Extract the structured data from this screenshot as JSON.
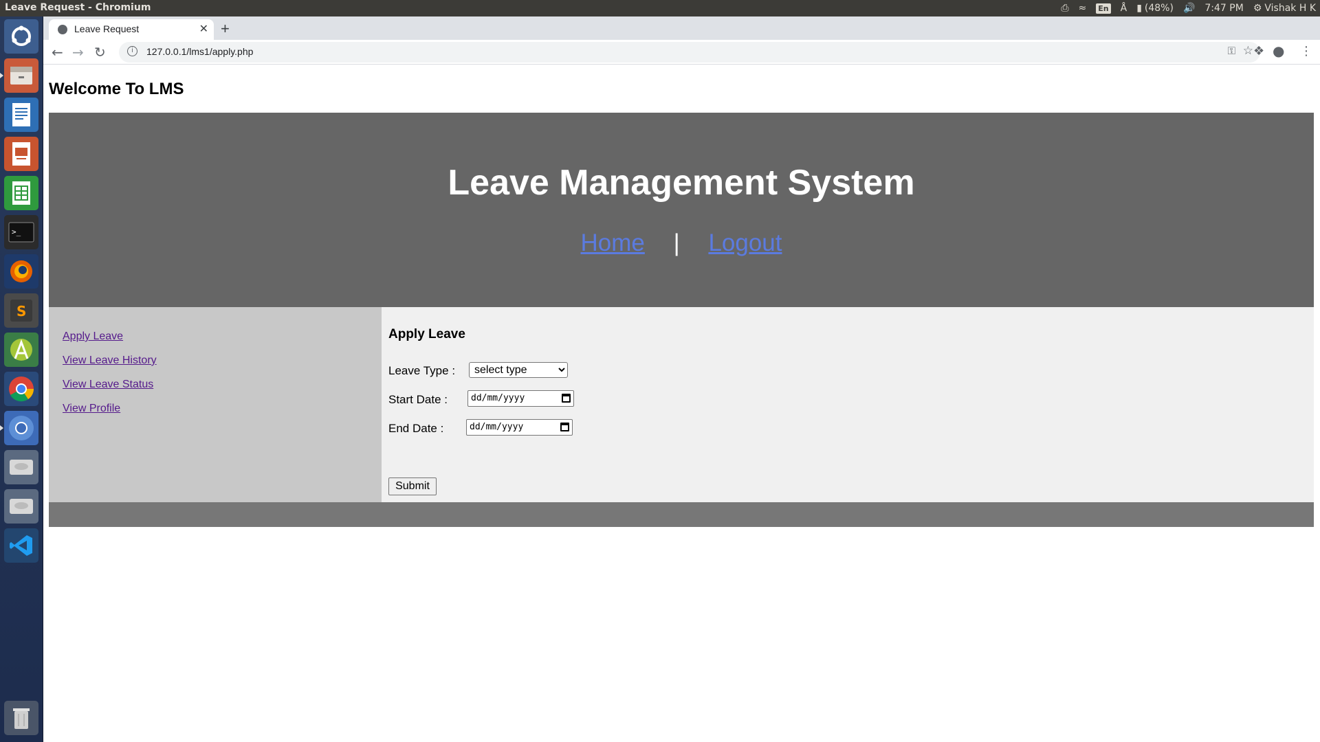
{
  "os": {
    "window_title": "Leave Request - Chromium",
    "battery": "(48%)",
    "time": "7:47 PM",
    "user": "Vishak H K",
    "keyboard_layout": "En"
  },
  "launcher": {
    "items": [
      "dash-home-icon",
      "files-icon",
      "writer-icon",
      "impress-icon",
      "calc-icon",
      "terminal-icon",
      "firefox-icon",
      "sublime-text-icon",
      "android-studio-icon",
      "chrome-icon",
      "chromium-icon",
      "disk-drive-icon",
      "disk-drive-icon",
      "vscode-icon",
      "trash-icon"
    ]
  },
  "browser": {
    "tab_title": "Leave Request",
    "url": "127.0.0.1/lms1/apply.php"
  },
  "page": {
    "welcome": "Welcome To LMS",
    "header_title": "Leave Management System",
    "nav_home": "Home",
    "nav_separator": "|",
    "nav_logout": "Logout",
    "sidebar": {
      "apply_leave": "Apply Leave",
      "view_history": "View Leave History",
      "view_status": "View Leave Status",
      "view_profile": "View Profile"
    },
    "form": {
      "heading": "Apply Leave",
      "leave_type_label": "Leave Type :",
      "leave_type_value": "select type",
      "start_date_label": "Start Date :",
      "start_date_value": "dd/mm/yyyy",
      "end_date_label": "End Date :",
      "end_date_value": "dd/mm/yyyy",
      "submit_label": "Submit"
    }
  },
  "colors": {
    "header_bg": "#666666",
    "sidebar_bg": "#c8c8c8",
    "main_bg": "#f0f0f0",
    "footer_bg": "#777777",
    "link_color": "#5b7be0",
    "visited_link": "#551a8b"
  }
}
